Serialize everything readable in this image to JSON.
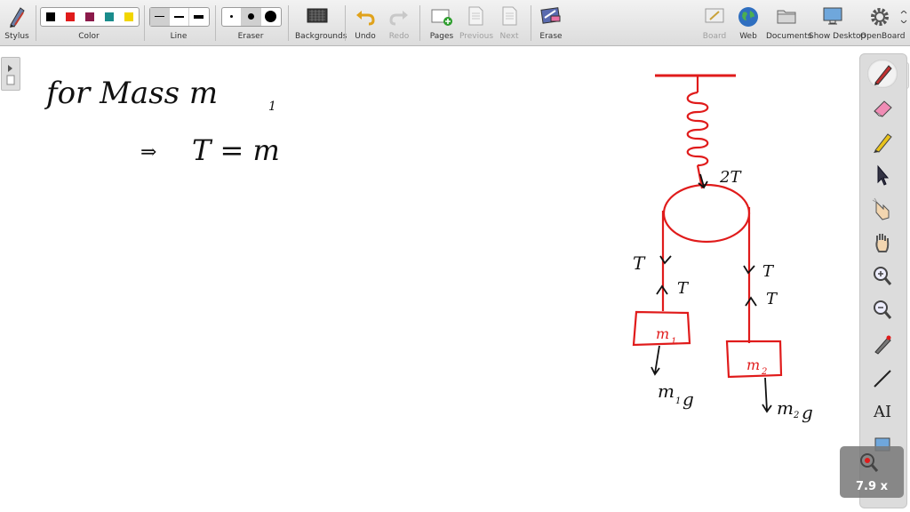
{
  "toolbar": {
    "stylus": "Stylus",
    "color": "Color",
    "line": "Line",
    "eraser": "Eraser",
    "backgrounds": "Backgrounds",
    "undo": "Undo",
    "redo": "Redo",
    "pages": "Pages",
    "previous": "Previous",
    "next": "Next",
    "erase": "Erase",
    "board": "Board",
    "web": "Web",
    "documents": "Documents",
    "show_desktop": "Show Desktop",
    "openboard": "OpenBoard"
  },
  "colors": {
    "swatches": [
      "#000000",
      "#e01b1b",
      "#8b1a4a",
      "#1a8c8c",
      "#f2d600"
    ],
    "ink": "#111111",
    "red_ink": "#e01b1b"
  },
  "canvas_text": {
    "line1": "for Mass m",
    "line1_sub": "1",
    "line2_arrow": "⇒",
    "line2": "T = m",
    "tension_top": "2T",
    "t_left_down": "T",
    "t_left_up": "T",
    "t_right_down": "T",
    "t_right_up": "T",
    "block1": "m",
    "block1_sub": "1",
    "block2": "m",
    "block2_sub": "2",
    "weight1": "m",
    "weight1_sub": "1",
    "weight1_g": "g",
    "weight2": "m",
    "weight2_sub": "2",
    "weight2_g": "g"
  },
  "side_tools": [
    "pen-tool",
    "eraser-tool",
    "highlighter-tool",
    "selector-tool",
    "interact-tool",
    "hand-tool",
    "zoom-in-tool",
    "zoom-out-tool",
    "laser-pointer-tool",
    "line-tool",
    "text-tool",
    "capture-tool"
  ],
  "side_text_tool": "AI",
  "zoom": {
    "label": "7.9 x"
  }
}
